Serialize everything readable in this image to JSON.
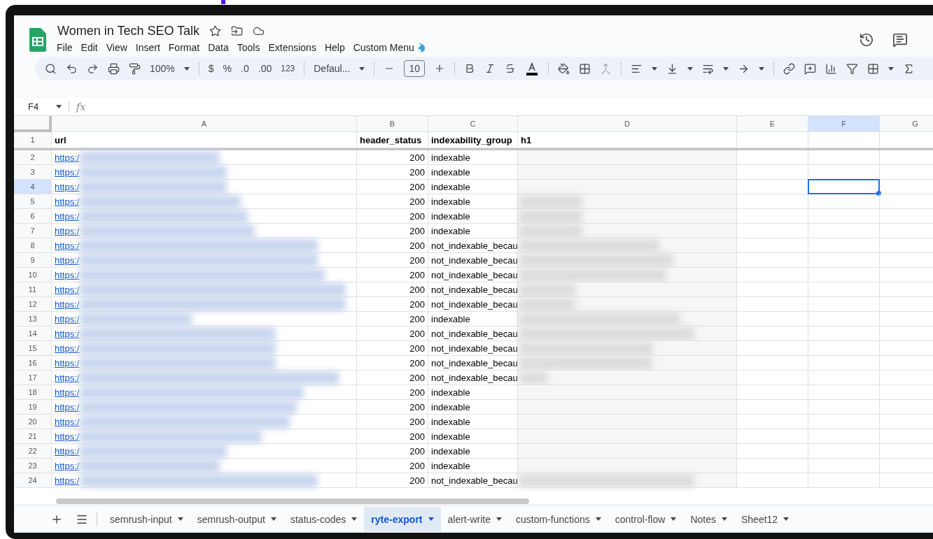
{
  "document": {
    "title": "Women in Tech SEO Talk"
  },
  "menus": [
    "File",
    "Edit",
    "View",
    "Insert",
    "Format",
    "Data",
    "Tools",
    "Extensions",
    "Help",
    "Custom Menu"
  ],
  "toolbar": {
    "zoom": "100%",
    "currency": "$",
    "percent": "%",
    "decrease_decimal": ".0",
    "increase_decimal": ".00",
    "number_format": "123",
    "font": "Defaul...",
    "font_size": "10"
  },
  "formula_bar": {
    "cell_ref": "F4",
    "fx": "fx"
  },
  "columns": [
    {
      "letter": "A",
      "selected": false
    },
    {
      "letter": "B",
      "selected": false
    },
    {
      "letter": "C",
      "selected": false
    },
    {
      "letter": "D",
      "selected": false
    },
    {
      "letter": "E",
      "selected": false
    },
    {
      "letter": "F",
      "selected": true
    },
    {
      "letter": "G",
      "selected": false
    }
  ],
  "header_row": {
    "number": "1",
    "cells": [
      "url",
      "header_status",
      "indexability_group",
      "h1"
    ]
  },
  "rows": [
    {
      "number": "2",
      "url": "https:/",
      "status": "200",
      "group": "indexable",
      "h1_redacted": false,
      "selected": false
    },
    {
      "number": "3",
      "url": "https:/",
      "status": "200",
      "group": "indexable",
      "h1_redacted": false,
      "selected": false
    },
    {
      "number": "4",
      "url": "https:/",
      "status": "200",
      "group": "indexable",
      "h1_redacted": false,
      "selected": true
    },
    {
      "number": "5",
      "url": "https:/",
      "status": "200",
      "group": "indexable",
      "h1_redacted": true,
      "selected": false
    },
    {
      "number": "6",
      "url": "https:/",
      "status": "200",
      "group": "indexable",
      "h1_redacted": true,
      "selected": false
    },
    {
      "number": "7",
      "url": "https:/",
      "status": "200",
      "group": "indexable",
      "h1_redacted": true,
      "selected": false
    },
    {
      "number": "8",
      "url": "https:/",
      "status": "200",
      "group": "not_indexable_becau",
      "h1_redacted": true,
      "selected": false
    },
    {
      "number": "9",
      "url": "https:/",
      "status": "200",
      "group": "not_indexable_becau",
      "h1_redacted": true,
      "selected": false
    },
    {
      "number": "10",
      "url": "https:/",
      "status": "200",
      "group": "not_indexable_becau",
      "h1_redacted": true,
      "selected": false
    },
    {
      "number": "11",
      "url": "https:/",
      "status": "200",
      "group": "not_indexable_becau",
      "h1_redacted": true,
      "selected": false
    },
    {
      "number": "12",
      "url": "https:/",
      "status": "200",
      "group": "not_indexable_becau",
      "h1_redacted": true,
      "selected": false
    },
    {
      "number": "13",
      "url": "https:/",
      "status": "200",
      "group": "indexable",
      "h1_redacted": true,
      "selected": false
    },
    {
      "number": "14",
      "url": "https:/",
      "status": "200",
      "group": "not_indexable_becau",
      "h1_redacted": true,
      "selected": false
    },
    {
      "number": "15",
      "url": "https:/",
      "status": "200",
      "group": "not_indexable_becau",
      "h1_redacted": true,
      "selected": false
    },
    {
      "number": "16",
      "url": "https:/",
      "status": "200",
      "group": "not_indexable_becau",
      "h1_redacted": true,
      "selected": false
    },
    {
      "number": "17",
      "url": "https:/",
      "status": "200",
      "group": "not_indexable_becau",
      "h1_redacted": true,
      "selected": false
    },
    {
      "number": "18",
      "url": "https:/",
      "status": "200",
      "group": "indexable",
      "h1_redacted": false,
      "selected": false
    },
    {
      "number": "19",
      "url": "https:/",
      "status": "200",
      "group": "indexable",
      "h1_redacted": false,
      "selected": false
    },
    {
      "number": "20",
      "url": "https:/",
      "status": "200",
      "group": "indexable",
      "h1_redacted": false,
      "selected": false
    },
    {
      "number": "21",
      "url": "https:/",
      "status": "200",
      "group": "indexable",
      "h1_redacted": false,
      "selected": false
    },
    {
      "number": "22",
      "url": "https:/",
      "status": "200",
      "group": "indexable",
      "h1_redacted": false,
      "selected": false
    },
    {
      "number": "23",
      "url": "https:/",
      "status": "200",
      "group": "indexable",
      "h1_redacted": false,
      "selected": false
    },
    {
      "number": "24",
      "url": "https:/",
      "status": "200",
      "group": "not_indexable_becau",
      "h1_redacted": true,
      "selected": false
    }
  ],
  "sheet_tabs": [
    {
      "label": "semrush-input",
      "selected": false
    },
    {
      "label": "semrush-output",
      "selected": false
    },
    {
      "label": "status-codes",
      "selected": false
    },
    {
      "label": "ryte-export",
      "selected": true
    },
    {
      "label": "alert-write",
      "selected": false
    },
    {
      "label": "custom-functions",
      "selected": false
    },
    {
      "label": "control-flow",
      "selected": false
    },
    {
      "label": "Notes",
      "selected": false
    },
    {
      "label": "Sheet12",
      "selected": false
    }
  ]
}
